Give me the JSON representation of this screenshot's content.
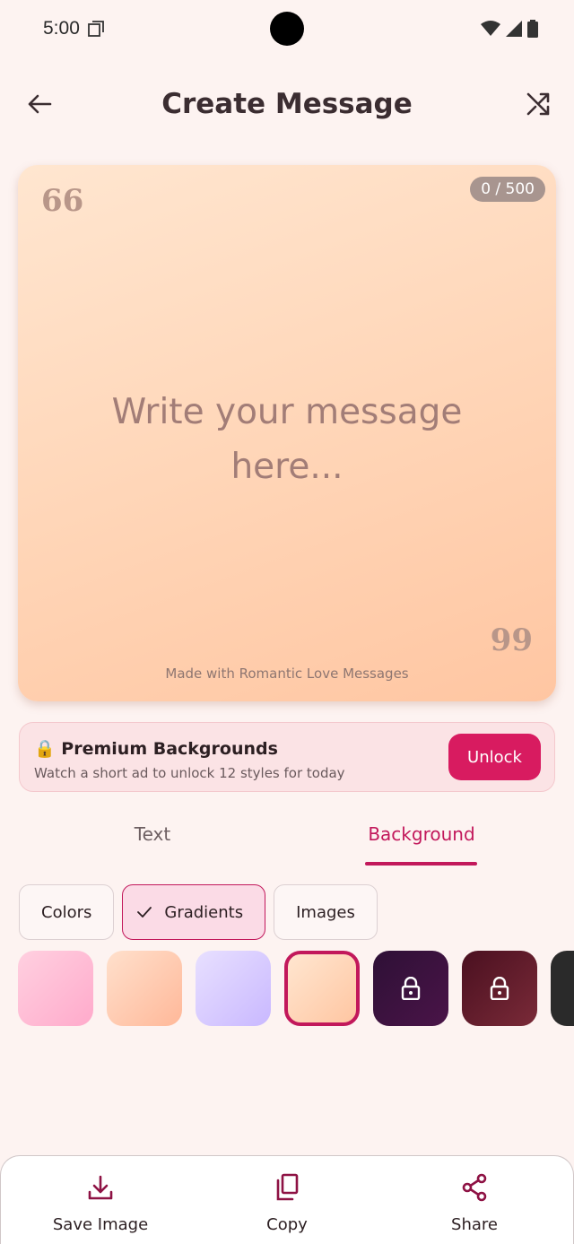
{
  "status_bar": {
    "time": "5:00"
  },
  "app_bar": {
    "title": "Create Message"
  },
  "card": {
    "open_quote": "66",
    "close_quote": "99",
    "char_count": "0 / 500",
    "placeholder": "Write your message here...",
    "watermark": "Made with Romantic Love Messages"
  },
  "premium": {
    "lock_emoji": "🔒",
    "title": "Premium Backgrounds",
    "subtitle": "Watch a short ad to unlock 12 styles for today",
    "unlock_label": "Unlock"
  },
  "tabs": [
    {
      "label": "Text",
      "selected": false
    },
    {
      "label": "Background",
      "selected": true
    }
  ],
  "chips": [
    {
      "label": "Colors",
      "selected": false
    },
    {
      "label": "Gradients",
      "selected": true
    },
    {
      "label": "Images",
      "selected": false
    }
  ],
  "swatches": [
    {
      "name": "pink-gradient",
      "locked": false,
      "selected": false,
      "colors": [
        "#ffd0e0",
        "#ffaacb"
      ]
    },
    {
      "name": "peach-gradient",
      "locked": false,
      "selected": false,
      "colors": [
        "#ffe0cc",
        "#ffb899"
      ]
    },
    {
      "name": "lavender-gradient",
      "locked": false,
      "selected": false,
      "colors": [
        "#e8e0ff",
        "#c9b8ff"
      ]
    },
    {
      "name": "apricot-gradient",
      "locked": false,
      "selected": true,
      "colors": [
        "#ffe6d0",
        "#ffc6a2"
      ]
    },
    {
      "name": "plum-gradient",
      "locked": true,
      "selected": false,
      "colors": [
        "#2e1036",
        "#4a1448"
      ]
    },
    {
      "name": "wine-gradient",
      "locked": true,
      "selected": false,
      "colors": [
        "#4a1020",
        "#7a2a38"
      ]
    }
  ],
  "bottom_actions": {
    "save_label": "Save Image",
    "copy_label": "Copy",
    "share_label": "Share"
  },
  "colors": {
    "accent": "#c2185b",
    "unlock_button": "#d81b60",
    "background": "#fdf3f1"
  }
}
